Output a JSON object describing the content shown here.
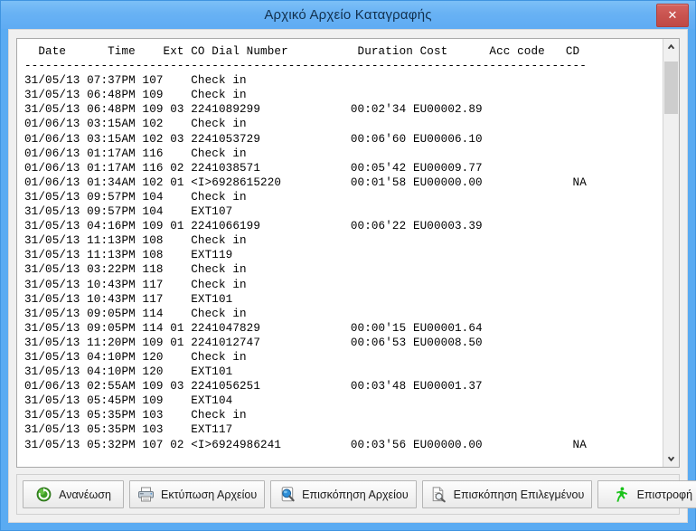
{
  "window": {
    "title": "Αρχικό Αρχείο Καταγραφής",
    "close_label": "✕",
    "accent_color": "#5aabf2",
    "close_color": "#c9534f"
  },
  "log": {
    "columns": [
      "Date",
      "Time",
      "Ext",
      "CO",
      "Dial Number",
      "Duration",
      "Cost",
      "Acc code",
      "CD"
    ],
    "header_line": "  Date      Time    Ext CO Dial Number          Duration Cost      Acc code   CD",
    "separator_line": "---------------------------------------------------------------------------------",
    "rows": [
      {
        "date": "31/05/13",
        "time": "07:37PM",
        "ext": "107",
        "co": "",
        "dial": "Check in",
        "duration": "",
        "cost": "",
        "acc": "",
        "cd": ""
      },
      {
        "date": "31/05/13",
        "time": "06:48PM",
        "ext": "109",
        "co": "",
        "dial": "Check in",
        "duration": "",
        "cost": "",
        "acc": "",
        "cd": ""
      },
      {
        "date": "31/05/13",
        "time": "06:48PM",
        "ext": "109",
        "co": "03",
        "dial": "2241089299",
        "duration": "00:02'34",
        "cost": "EU00002.89",
        "acc": "",
        "cd": ""
      },
      {
        "date": "01/06/13",
        "time": "03:15AM",
        "ext": "102",
        "co": "",
        "dial": "Check in",
        "duration": "",
        "cost": "",
        "acc": "",
        "cd": ""
      },
      {
        "date": "01/06/13",
        "time": "03:15AM",
        "ext": "102",
        "co": "03",
        "dial": "2241053729",
        "duration": "00:06'60",
        "cost": "EU00006.10",
        "acc": "",
        "cd": ""
      },
      {
        "date": "01/06/13",
        "time": "01:17AM",
        "ext": "116",
        "co": "",
        "dial": "Check in",
        "duration": "",
        "cost": "",
        "acc": "",
        "cd": ""
      },
      {
        "date": "01/06/13",
        "time": "01:17AM",
        "ext": "116",
        "co": "02",
        "dial": "2241038571",
        "duration": "00:05'42",
        "cost": "EU00009.77",
        "acc": "",
        "cd": ""
      },
      {
        "date": "01/06/13",
        "time": "01:34AM",
        "ext": "102",
        "co": "01",
        "dial": "<I>6928615220",
        "duration": "00:01'58",
        "cost": "EU00000.00",
        "acc": "",
        "cd": "NA"
      },
      {
        "date": "31/05/13",
        "time": "09:57PM",
        "ext": "104",
        "co": "",
        "dial": "Check in",
        "duration": "",
        "cost": "",
        "acc": "",
        "cd": ""
      },
      {
        "date": "31/05/13",
        "time": "09:57PM",
        "ext": "104",
        "co": "",
        "dial": "EXT107",
        "duration": "",
        "cost": "",
        "acc": "",
        "cd": ""
      },
      {
        "date": "31/05/13",
        "time": "04:16PM",
        "ext": "109",
        "co": "01",
        "dial": "2241066199",
        "duration": "00:06'22",
        "cost": "EU00003.39",
        "acc": "",
        "cd": ""
      },
      {
        "date": "31/05/13",
        "time": "11:13PM",
        "ext": "108",
        "co": "",
        "dial": "Check in",
        "duration": "",
        "cost": "",
        "acc": "",
        "cd": ""
      },
      {
        "date": "31/05/13",
        "time": "11:13PM",
        "ext": "108",
        "co": "",
        "dial": "EXT119",
        "duration": "",
        "cost": "",
        "acc": "",
        "cd": ""
      },
      {
        "date": "31/05/13",
        "time": "03:22PM",
        "ext": "118",
        "co": "",
        "dial": "Check in",
        "duration": "",
        "cost": "",
        "acc": "",
        "cd": ""
      },
      {
        "date": "31/05/13",
        "time": "10:43PM",
        "ext": "117",
        "co": "",
        "dial": "Check in",
        "duration": "",
        "cost": "",
        "acc": "",
        "cd": ""
      },
      {
        "date": "31/05/13",
        "time": "10:43PM",
        "ext": "117",
        "co": "",
        "dial": "EXT101",
        "duration": "",
        "cost": "",
        "acc": "",
        "cd": ""
      },
      {
        "date": "31/05/13",
        "time": "09:05PM",
        "ext": "114",
        "co": "",
        "dial": "Check in",
        "duration": "",
        "cost": "",
        "acc": "",
        "cd": ""
      },
      {
        "date": "31/05/13",
        "time": "09:05PM",
        "ext": "114",
        "co": "01",
        "dial": "2241047829",
        "duration": "00:00'15",
        "cost": "EU00001.64",
        "acc": "",
        "cd": ""
      },
      {
        "date": "31/05/13",
        "time": "11:20PM",
        "ext": "109",
        "co": "01",
        "dial": "2241012747",
        "duration": "00:06'53",
        "cost": "EU00008.50",
        "acc": "",
        "cd": ""
      },
      {
        "date": "31/05/13",
        "time": "04:10PM",
        "ext": "120",
        "co": "",
        "dial": "Check in",
        "duration": "",
        "cost": "",
        "acc": "",
        "cd": ""
      },
      {
        "date": "31/05/13",
        "time": "04:10PM",
        "ext": "120",
        "co": "",
        "dial": "EXT101",
        "duration": "",
        "cost": "",
        "acc": "",
        "cd": ""
      },
      {
        "date": "01/06/13",
        "time": "02:55AM",
        "ext": "109",
        "co": "03",
        "dial": "2241056251",
        "duration": "00:03'48",
        "cost": "EU00001.37",
        "acc": "",
        "cd": ""
      },
      {
        "date": "31/05/13",
        "time": "05:45PM",
        "ext": "109",
        "co": "",
        "dial": "EXT104",
        "duration": "",
        "cost": "",
        "acc": "",
        "cd": ""
      },
      {
        "date": "31/05/13",
        "time": "05:35PM",
        "ext": "103",
        "co": "",
        "dial": "Check in",
        "duration": "",
        "cost": "",
        "acc": "",
        "cd": ""
      },
      {
        "date": "31/05/13",
        "time": "05:35PM",
        "ext": "103",
        "co": "",
        "dial": "EXT117",
        "duration": "",
        "cost": "",
        "acc": "",
        "cd": ""
      },
      {
        "date": "31/05/13",
        "time": "05:32PM",
        "ext": "107",
        "co": "02",
        "dial": "<I>6924986241",
        "duration": "00:03'56",
        "cost": "EU00000.00",
        "acc": "",
        "cd": "NA"
      }
    ]
  },
  "scrollbar": {
    "up_arrow": "▲",
    "down_arrow": "▼"
  },
  "buttons": [
    {
      "label": "Ανανέωση",
      "icon": "refresh-icon"
    },
    {
      "label": "Εκτύπωση Αρχείου",
      "icon": "printer-icon"
    },
    {
      "label": "Επισκόπηση Αρχείου",
      "icon": "preview-file-icon"
    },
    {
      "label": "Επισκόπηση Επιλεγμένου",
      "icon": "preview-selected-icon"
    },
    {
      "label": "Επιστροφή",
      "icon": "exit-runner-icon"
    }
  ]
}
